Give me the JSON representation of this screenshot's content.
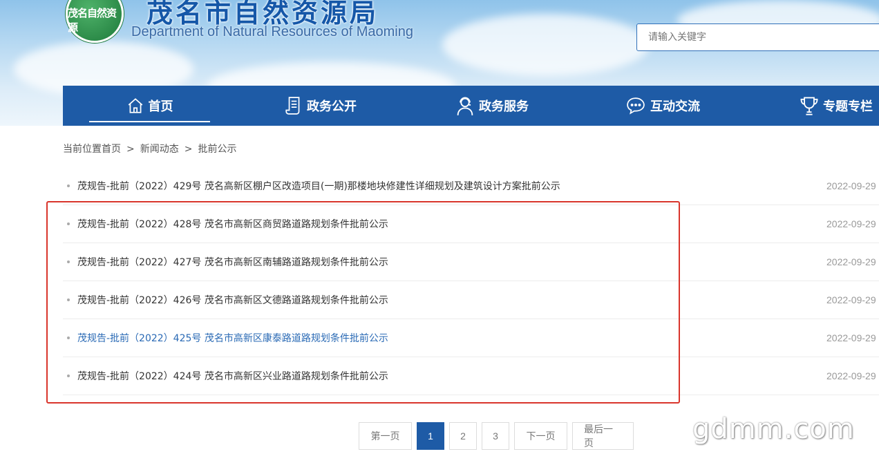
{
  "header": {
    "logo_text": "茂名自然资源",
    "title": "茂名市自然资源局",
    "subtitle": "Department of Natural Resources of Maoming",
    "search_placeholder": "请输入关键字"
  },
  "nav": {
    "items": [
      {
        "label": "首页",
        "icon": "home-icon",
        "active": true
      },
      {
        "label": "政务公开",
        "icon": "scroll-icon",
        "active": false
      },
      {
        "label": "政务服务",
        "icon": "service-person-icon",
        "active": false
      },
      {
        "label": "互动交流",
        "icon": "chat-bubble-icon",
        "active": false
      },
      {
        "label": "专题专栏",
        "icon": "trophy-icon",
        "active": false
      }
    ]
  },
  "breadcrumb": {
    "prefix": "当前位置",
    "items": [
      "首页",
      "新闻动态",
      "批前公示"
    ],
    "separator": ">"
  },
  "list": {
    "items": [
      {
        "title": "茂规告-批前（2022）429号 茂名高新区棚户区改造项目(一期)那楼地块修建性详细规划及建筑设计方案批前公示",
        "date": "2022-09-29"
      },
      {
        "title": "茂规告-批前（2022）428号 茂名市高新区商贸路道路规划条件批前公示",
        "date": "2022-09-29"
      },
      {
        "title": "茂规告-批前（2022）427号 茂名市高新区南辅路道路规划条件批前公示",
        "date": "2022-09-29"
      },
      {
        "title": "茂规告-批前（2022）426号 茂名市高新区文德路道路规划条件批前公示",
        "date": "2022-09-29"
      },
      {
        "title": "茂规告-批前（2022）425号 茂名市高新区康泰路道路规划条件批前公示",
        "date": "2022-09-29"
      },
      {
        "title": "茂规告-批前（2022）424号 茂名市高新区兴业路道路规划条件批前公示",
        "date": "2022-09-29"
      }
    ]
  },
  "pagination": {
    "first": "第一页",
    "pages": [
      "1",
      "2",
      "3"
    ],
    "current": "1",
    "next": "下一页",
    "last": "最后一页"
  },
  "watermark": "gdmm.com",
  "colors": {
    "nav_bg": "#1e5ba6",
    "title_blue": "#1557a8",
    "highlight_red": "#d9342b",
    "link_hover": "#2a6ab5"
  }
}
